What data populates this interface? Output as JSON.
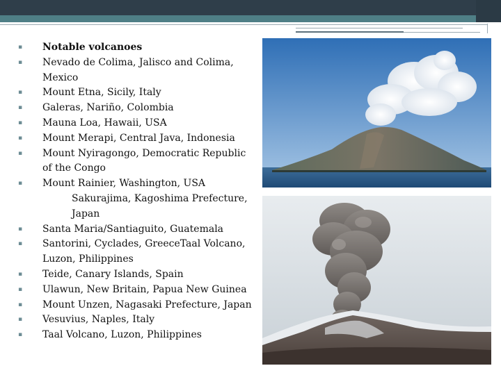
{
  "volcano_list": {
    "items": [
      {
        "text": "Notable volcanoes",
        "bold": true
      },
      {
        "text": "Nevado de Colima, Jalisco and Colima, Mexico"
      },
      {
        "text": "Mount Etna, Sicily, Italy"
      },
      {
        "text": "Galeras, Nariño, Colombia"
      },
      {
        "text": "Mauna Loa, Hawaii, USA"
      },
      {
        "text": "Mount Merapi, Central Java, Indonesia"
      },
      {
        "text": "Mount Nyiragongo, Democratic Republic of the Congo"
      },
      {
        "text": "Mount Rainier, Washington, USA",
        "cont": "Sakurajima, Kagoshima Prefecture, Japan"
      },
      {
        "text": "Santa Maria/Santiaguito, Guatemala"
      },
      {
        "text": "Santorini, Cyclades, GreeceTaal Volcano, Luzon, Philippines"
      },
      {
        "text": "Teide, Canary Islands, Spain"
      },
      {
        "text": "Ulawun, New Britain, Papua New Guinea"
      },
      {
        "text": "Mount Unzen, Nagasaki Prefecture, Japan"
      },
      {
        "text": "Vesuvius, Naples, Italy"
      },
      {
        "text": "Taal Volcano, Luzon, Philippines"
      }
    ]
  },
  "colors": {
    "header_dark": "#2f3e4a",
    "header_teal": "#4f7f86",
    "bullet": "#6c8c94"
  }
}
